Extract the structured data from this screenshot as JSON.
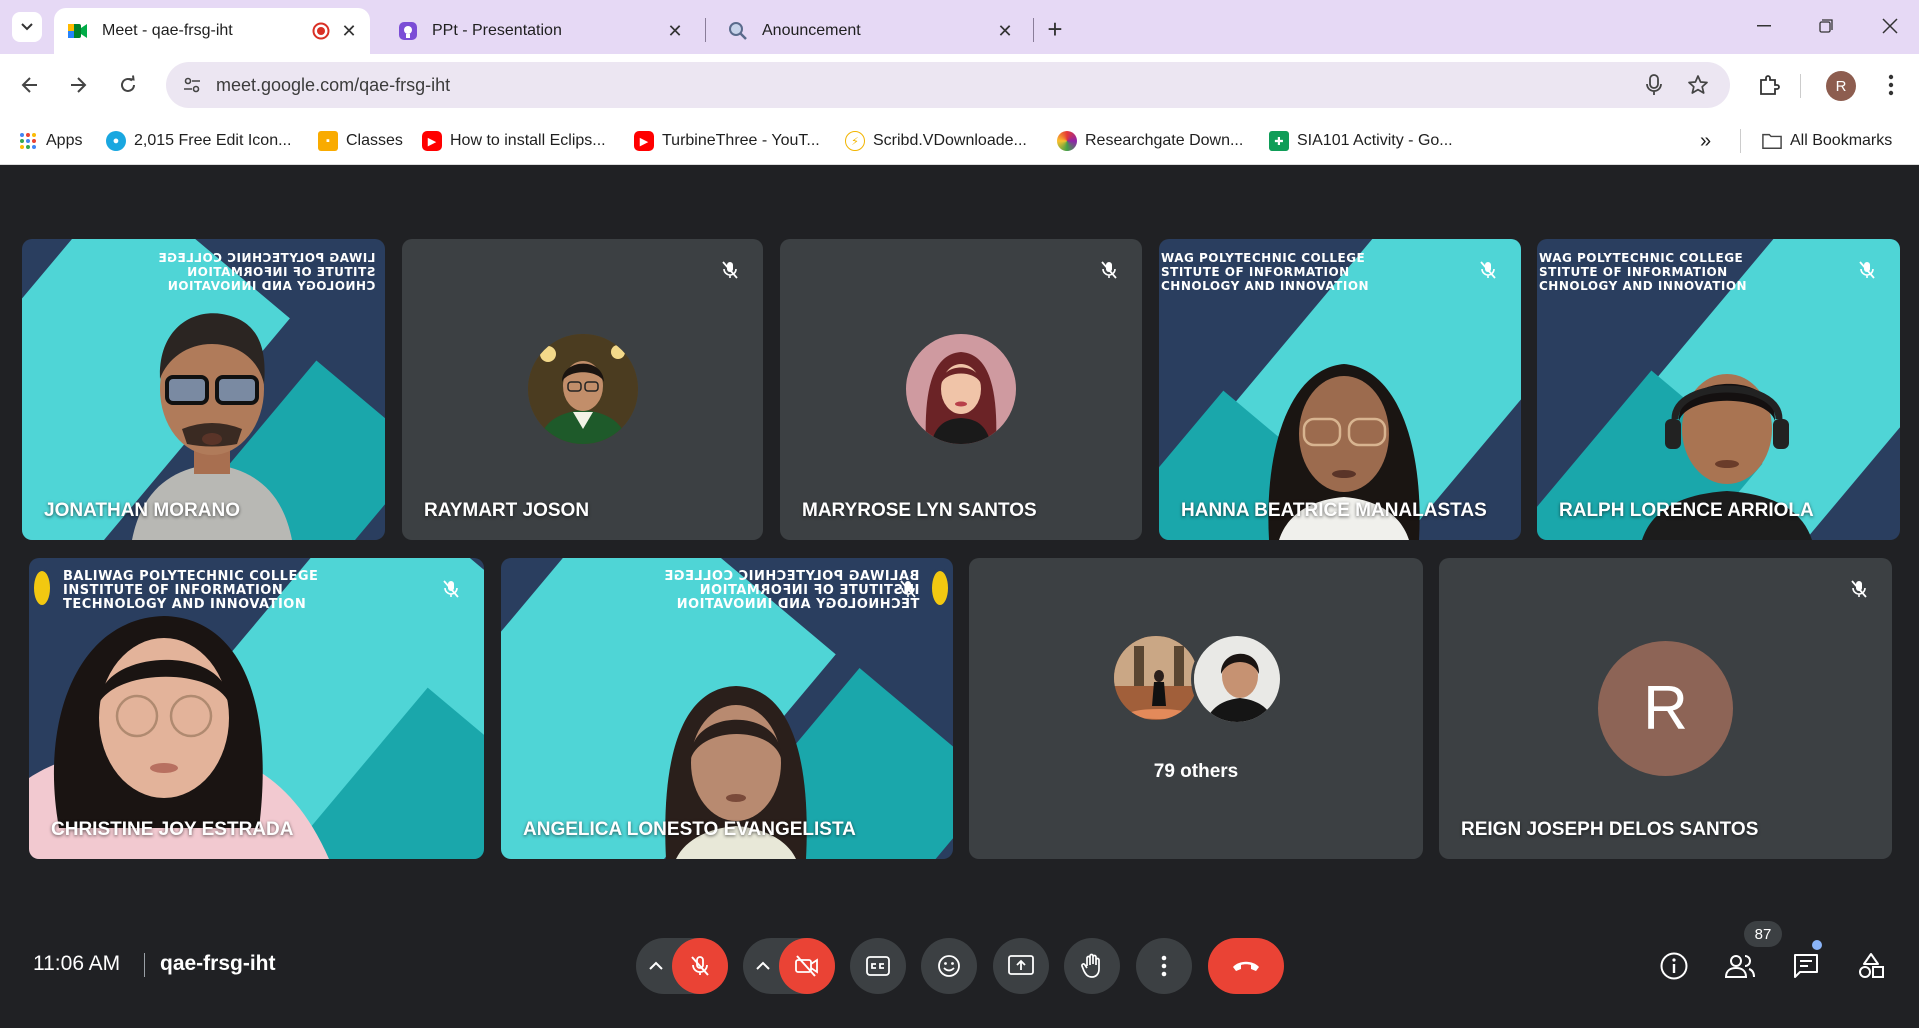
{
  "browser": {
    "tabs": [
      {
        "title": "Meet - qae-frsg-iht",
        "active": true
      },
      {
        "title": "PPt - Presentation",
        "active": false
      },
      {
        "title": "Anouncement",
        "active": false
      }
    ],
    "url": "meet.google.com/qae-frsg-iht",
    "profile_initial": "R",
    "bookmarks": [
      {
        "label": "Apps"
      },
      {
        "label": "2,015 Free Edit Icon..."
      },
      {
        "label": "Classes"
      },
      {
        "label": "How to install Eclips..."
      },
      {
        "label": "TurbineThree - YouT..."
      },
      {
        "label": "Scribd.VDownloade..."
      },
      {
        "label": "Researchgate Down..."
      },
      {
        "label": "SIA101 Activity - Go..."
      }
    ],
    "all_bookmarks": "All Bookmarks"
  },
  "meet": {
    "participants": [
      {
        "name": "JONATHAN MORANO",
        "type": "video"
      },
      {
        "name": "RAYMART JOSON",
        "type": "avatar"
      },
      {
        "name": "MARYROSE LYN SANTOS",
        "type": "avatar"
      },
      {
        "name": "HANNA BEATRICE MANALASTAS",
        "type": "video"
      },
      {
        "name": "RALPH LORENCE ARRIOLA",
        "type": "video"
      },
      {
        "name": "CHRISTINE JOY ESTRADA",
        "type": "video"
      },
      {
        "name": "ANGELICA LONESTO EVANGELISTA",
        "type": "video"
      },
      {
        "name": "REIGN JOSEPH DELOS SANTOS",
        "type": "initial",
        "initial": "R"
      }
    ],
    "others_label": "79 others",
    "banner_text": "INSTITUTE OF INFORMATION TECHNOLOGY AND INNOVATION",
    "college": "BALIWAG POLYTECHNIC COLLEGE",
    "time": "11:06 AM",
    "code": "qae-frsg-iht",
    "people_count": "87"
  },
  "colors": {
    "meet_bg": "#202124",
    "tile_bg": "#3c4043",
    "end_call": "#ea4335",
    "teal": "#4fd5d6",
    "navy": "#2a3e5f"
  }
}
